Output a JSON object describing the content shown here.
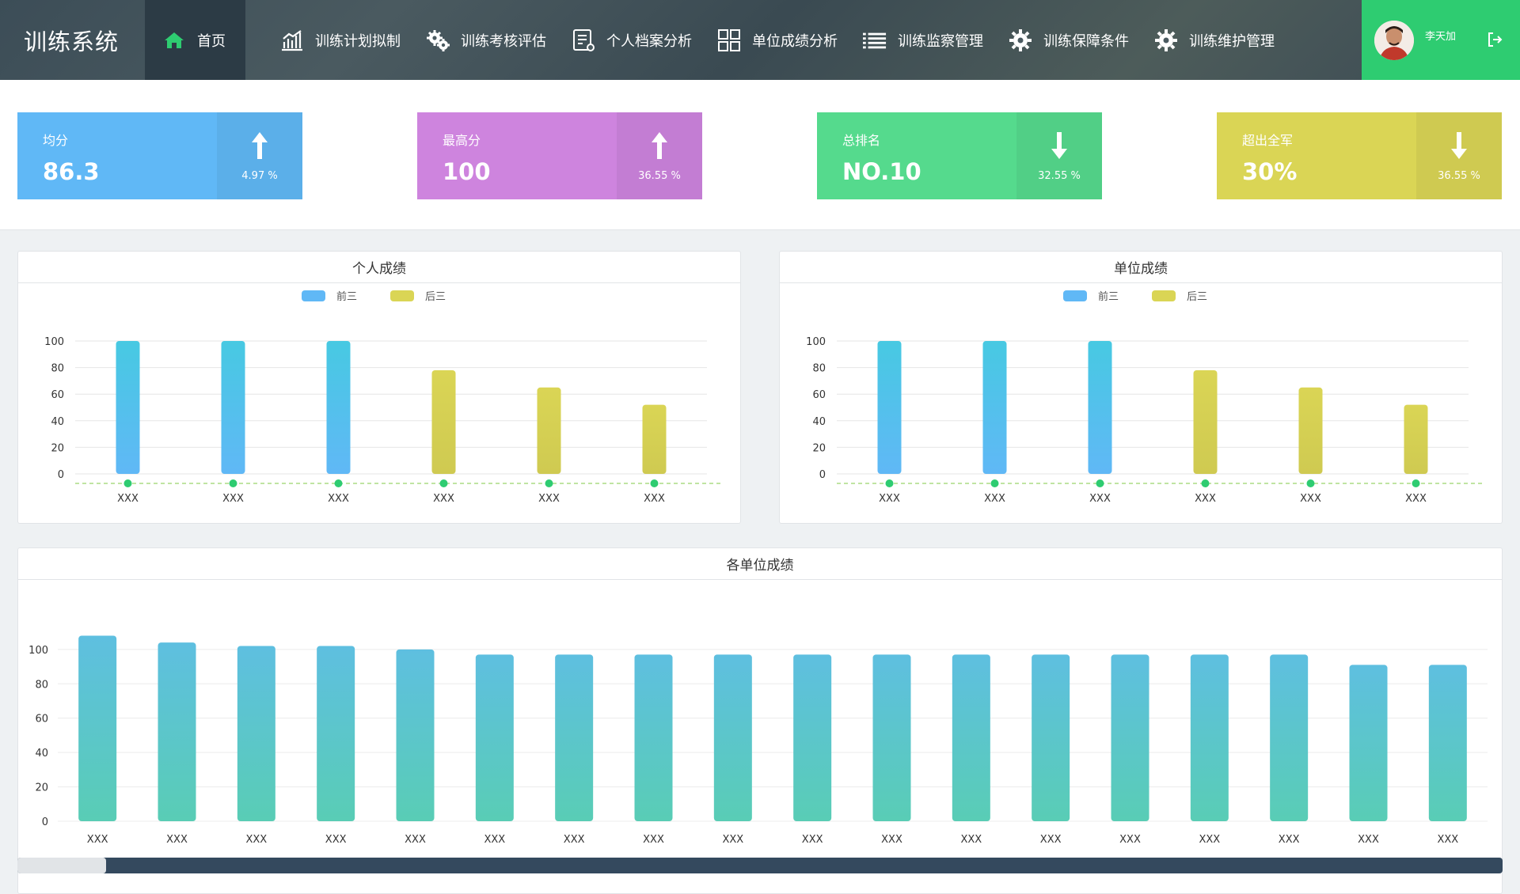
{
  "app": {
    "title": "训练系统"
  },
  "nav": {
    "items": [
      {
        "label": "首页",
        "icon": "home-icon"
      },
      {
        "label": "训练计划拟制",
        "icon": "bar-chart-icon"
      },
      {
        "label": "训练考核评估",
        "icon": "gears-icon"
      },
      {
        "label": "个人档案分析",
        "icon": "document-icon"
      },
      {
        "label": "单位成绩分析",
        "icon": "grid-icon"
      },
      {
        "label": "训练监察管理",
        "icon": "list-icon"
      },
      {
        "label": "训练保障条件",
        "icon": "gear-icon"
      },
      {
        "label": "训练维护管理",
        "icon": "gear-icon"
      }
    ]
  },
  "user": {
    "name": "李天加"
  },
  "colors": {
    "nav_active": "#2c3b45",
    "user_bg": "#2ecc71",
    "blue": "#5bafe9",
    "purple": "#c37dd3",
    "green": "#51cf86",
    "yellow": "#cfca51",
    "scroll_track": "#34495e",
    "scroll_thumb": "#e1e4e7"
  },
  "stats": [
    {
      "label": "均分",
      "value": "86.3",
      "pct": "4.97 %",
      "trend": "up",
      "main": "#60b8f6",
      "side": "#5bafe9"
    },
    {
      "label": "最高分",
      "value": "100",
      "pct": "36.55 %",
      "trend": "up",
      "main": "#ce84de",
      "side": "#c37dd3"
    },
    {
      "label": "总排名",
      "value": "NO.10",
      "pct": "32.55 %",
      "trend": "down",
      "main": "#55da8d",
      "side": "#51cf86"
    },
    {
      "label": "超出全军",
      "value": "30%",
      "pct": "36.55 %",
      "trend": "down",
      "main": "#dad555",
      "side": "#cfca51"
    }
  ],
  "chart_data": [
    {
      "type": "bar",
      "title": "个人成绩",
      "categories": [
        "XXX",
        "XXX",
        "XXX",
        "XXX",
        "XXX",
        "XXX"
      ],
      "series": [
        {
          "name": "前三",
          "values": [
            100,
            100,
            100,
            null,
            null,
            null
          ],
          "color_top": "#47c9e2",
          "color_bottom": "#60b8f6"
        },
        {
          "name": "后三",
          "values": [
            null,
            null,
            null,
            78,
            65,
            52
          ],
          "color_top": "#dad555",
          "color_bottom": "#cfca51"
        }
      ],
      "ylim": [
        0,
        100
      ],
      "yticks": [
        0,
        20,
        40,
        60,
        80,
        100
      ],
      "legend": "top-center",
      "grid": true
    },
    {
      "type": "bar",
      "title": "单位成绩",
      "categories": [
        "XXX",
        "XXX",
        "XXX",
        "XXX",
        "XXX",
        "XXX"
      ],
      "series": [
        {
          "name": "前三",
          "values": [
            100,
            100,
            100,
            null,
            null,
            null
          ],
          "color_top": "#47c9e2",
          "color_bottom": "#60b8f6"
        },
        {
          "name": "后三",
          "values": [
            null,
            null,
            null,
            78,
            65,
            52
          ],
          "color_top": "#dad555",
          "color_bottom": "#cfca51"
        }
      ],
      "ylim": [
        0,
        100
      ],
      "yticks": [
        0,
        20,
        40,
        60,
        80,
        100
      ],
      "legend": "top-center",
      "grid": true
    },
    {
      "type": "bar",
      "title": "各单位成绩",
      "categories": [
        "XXX",
        "XXX",
        "XXX",
        "XXX",
        "XXX",
        "XXX",
        "XXX",
        "XXX",
        "XXX",
        "XXX",
        "XXX",
        "XXX",
        "XXX",
        "XXX",
        "XXX",
        "XXX",
        "XXX",
        "XXX"
      ],
      "values": [
        108,
        104,
        102,
        102,
        100,
        97,
        97,
        97,
        97,
        97,
        97,
        97,
        97,
        97,
        97,
        97,
        91,
        91
      ],
      "color_top": "#5ebfe0",
      "color_bottom": "#59cdb5",
      "ylim": [
        0,
        110
      ],
      "yticks": [
        0,
        20,
        40,
        60,
        80,
        100
      ],
      "grid": true
    }
  ]
}
